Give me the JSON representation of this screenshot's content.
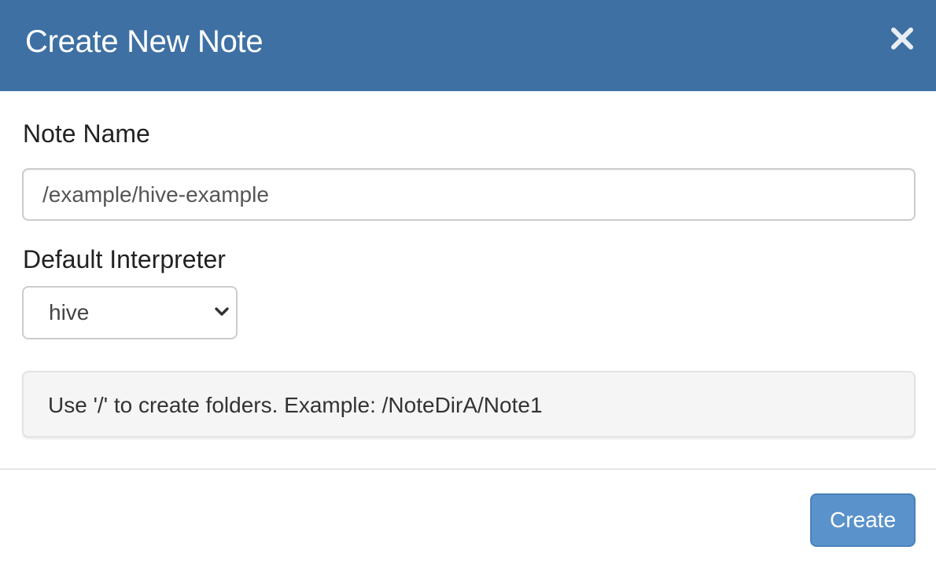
{
  "dialog": {
    "title": "Create New Note",
    "close_icon": "close-icon"
  },
  "note_name": {
    "label": "Note Name",
    "value": "/example/hive-example"
  },
  "interpreter": {
    "label": "Default Interpreter",
    "selected": "hive",
    "chevron_icon": "chevron-down-icon"
  },
  "hint": {
    "text": "Use '/' to create folders. Example: /NoteDirA/Note1"
  },
  "footer": {
    "create_label": "Create"
  },
  "colors": {
    "header_bg": "#3e70a3",
    "primary_button": "#5a92cc",
    "hint_bg": "#f5f5f5"
  }
}
